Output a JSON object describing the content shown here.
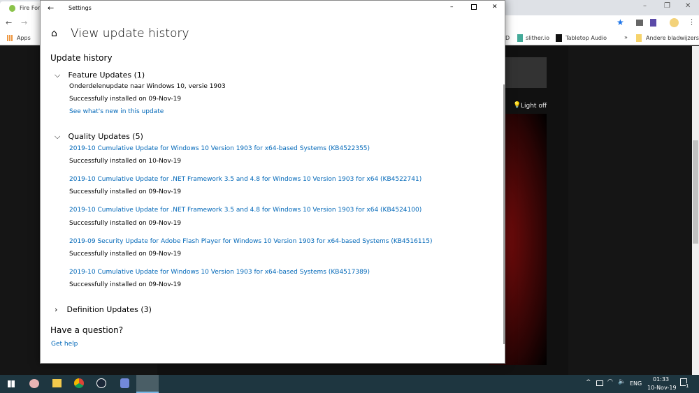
{
  "browser": {
    "tab_title": "Fire Forc",
    "bookmarks": [
      "Apps",
      "slither.io",
      "Tabletop Audio",
      "Andere bladwijzers"
    ],
    "bookmark_partial": "D"
  },
  "page": {
    "light_off": "Light off"
  },
  "settings": {
    "window_title": "Settings",
    "page_title": "View update history",
    "section_title": "Update history",
    "feature": {
      "header": "Feature Updates (1)",
      "items": [
        {
          "name": "Onderdelenupdate naar Windows 10, versie 1903",
          "status": "Successfully installed on 09-Nov-19",
          "link": "See what's new in this update"
        }
      ]
    },
    "quality": {
      "header": "Quality Updates (5)",
      "items": [
        {
          "name": "2019-10 Cumulative Update for Windows 10 Version 1903 for x64-based Systems (KB4522355)",
          "status": "Successfully installed on 10-Nov-19"
        },
        {
          "name": "2019-10 Cumulative Update for .NET Framework 3.5 and 4.8 for Windows 10 Version 1903 for x64 (KB4522741)",
          "status": "Successfully installed on 09-Nov-19"
        },
        {
          "name": "2019-10 Cumulative Update for .NET Framework 3.5 and 4.8 for Windows 10 Version 1903 for x64 (KB4524100)",
          "status": "Successfully installed on 09-Nov-19"
        },
        {
          "name": "2019-09 Security Update for Adobe Flash Player for Windows 10 Version 1903 for x64-based Systems (KB4516115)",
          "status": "Successfully installed on 09-Nov-19"
        },
        {
          "name": "2019-10 Cumulative Update for Windows 10 Version 1903 for x64-based Systems (KB4517389)",
          "status": "Successfully installed on 09-Nov-19"
        }
      ]
    },
    "definition": {
      "header": "Definition Updates (3)"
    },
    "question": "Have a question?",
    "get_help": "Get help"
  },
  "taskbar": {
    "lang": "ENG",
    "time": "01:33",
    "date": "10-Nov-19",
    "notifications": "1"
  }
}
